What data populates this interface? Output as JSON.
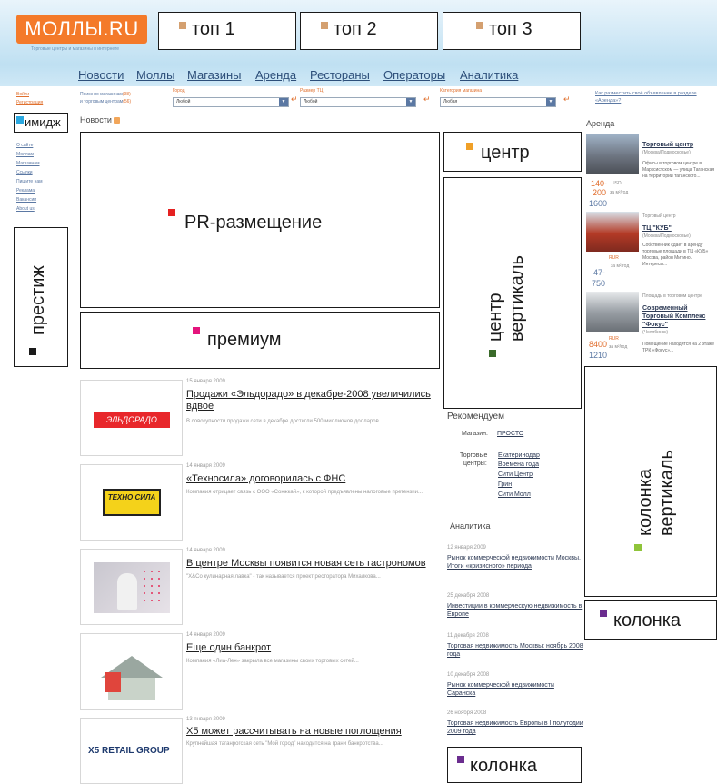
{
  "header": {
    "logo": "МОЛЛЫ.RU",
    "tagline": "Торговые центры и магазины в интернете"
  },
  "ad_slots": {
    "top1": "топ 1",
    "top2": "топ 2",
    "top3": "топ 3",
    "image": "имидж",
    "prestige": "престиж",
    "pr": "PR-размещение",
    "premium": "премиум",
    "center": "центр",
    "center_vertical_1": "центр",
    "center_vertical_2": "вертикаль",
    "column_vertical_1": "колонка",
    "column_vertical_2": "вертикаль",
    "column_right": "колонка",
    "column_bottom": "колонка"
  },
  "ad_colors": {
    "top": "#d4a070",
    "image": "#2aa8e0",
    "prestige": "#1a1a1a",
    "pr": "#e52121",
    "premium": "#e4147c",
    "center": "#f0a028",
    "center_vertical": "#3a6a2a",
    "column_vertical": "#8fc43a",
    "column": "#6b2d8f"
  },
  "nav": [
    "Новости",
    "Моллы",
    "Магазины",
    "Аренда",
    "Рестораны",
    "Операторы",
    "Аналитика"
  ],
  "login": {
    "enter": "Войти",
    "register": "Регистрация"
  },
  "filters": {
    "search_line1": "Поиск по магазинам",
    "search_line2": "и торговым центрам",
    "search_count1": "(98)",
    "search_count2": "(56)",
    "city_label": "Город",
    "city_value": "Любой",
    "size_label": "Размер ТЦ",
    "size_value": "Любой",
    "category_label": "Категория магазина",
    "category_value": "Любая",
    "ad_link": "Как разместить своё объявление в разделе «Аренда»?"
  },
  "side_links": [
    "О сайте",
    "Моллам",
    "Магазинам",
    "Ссылки",
    "Пишите нам",
    "Реклама",
    "Вакансии",
    "About us"
  ],
  "news_heading": "Новости",
  "news": [
    {
      "logo": "ЭЛЬДОРАДО",
      "date": "15 января 2009",
      "title": "Продажи «Эльдорадо» в декабре-2008 увеличились вдвое",
      "desc": "В совокупности продажи сети в декабре достигли 500 миллионов долларов..."
    },
    {
      "logo": "ТЕХНО СИЛА",
      "date": "14 января 2009",
      "title": "«Техносила» договорилась с ФНС",
      "desc": "Компания отрицает связь с ООО «Сонжкай», к которой предъявлены налоговые претензии..."
    },
    {
      "logo": "",
      "date": "14 января 2009",
      "title": "В центре Москвы появится новая сеть гастрономов",
      "desc": "\"X&Co кулинарная лавка\" - так называется проект ресторатора Михалкова..."
    },
    {
      "logo": "",
      "date": "14 января 2009",
      "title": "Еще один банкрот",
      "desc": "Компания «Лиа-Лен» закрыла все магазины своих торговых сетей..."
    },
    {
      "logo": "X5 RETAIL GROUP",
      "date": "13 января 2009",
      "title": "X5 может рассчитывать на новые поглощения",
      "desc": "Крупнейшая таганрогская сеть \"Мой город\" находится на грани банкротства..."
    }
  ],
  "recommend": {
    "heading": "Рекомендуем",
    "shop_label": "Магазин:",
    "shop": "ПРОСТО",
    "centers_label_1": "Торговые",
    "centers_label_2": "центры:",
    "centers": [
      "Екатеринодар",
      "Времена года",
      "Сити Центр",
      "Грин",
      "Сити Молл"
    ]
  },
  "analytics": {
    "heading": "Аналитика",
    "items": [
      {
        "date": "12 января 2009",
        "title": "Рынок коммерческой недвижимости Москвы. Итоги «кризисного» периода"
      },
      {
        "date": "25 декабря 2008",
        "title": "Инвестиции в коммерческую недвижимость в Европе"
      },
      {
        "date": "11 декабря 2008",
        "title": "Торговая недвижимость Москвы: ноябрь 2008 года"
      },
      {
        "date": "10 декабря 2008",
        "title": "Рынок коммерческой недвижимости Саранска"
      },
      {
        "date": "26 ноября 2008",
        "title": "Торговая недвижимость Европы в I полугодии 2009 года"
      }
    ]
  },
  "rent": {
    "heading": "Аренда",
    "items": [
      {
        "title": "Торговый центр",
        "sub": "(Москва/Подмосковье)",
        "desc": "Офисы в торговом центре в Марксистском — улица Таганская на территории таганского...",
        "price1": "140-",
        "price2": "200",
        "price3": "1600",
        "unit": "USD",
        "unit2": "за м²/год"
      },
      {
        "kind": "Торговый центр",
        "title": "ТЦ \"КУБ\"",
        "sub": "(Москва/Подмосковье)",
        "desc": "Собственник сдает в аренду торговые площади в ТЦ «КУБ» Москва, район Митино. Интересы...",
        "price1": "47-",
        "price2": "750",
        "unit": "RUR",
        "unit2": "за м²/год"
      },
      {
        "kind": "Площадь в торговом центре",
        "title": "Современный Торговый Комплекс \"Фокус\"",
        "sub": "(Челябинск)",
        "desc": "Помещение находится на 2 этаже ТРК «Фокус»...",
        "price1": "8400",
        "price2": "1210",
        "unit": "RUR",
        "unit2": "за м²/год"
      }
    ]
  }
}
